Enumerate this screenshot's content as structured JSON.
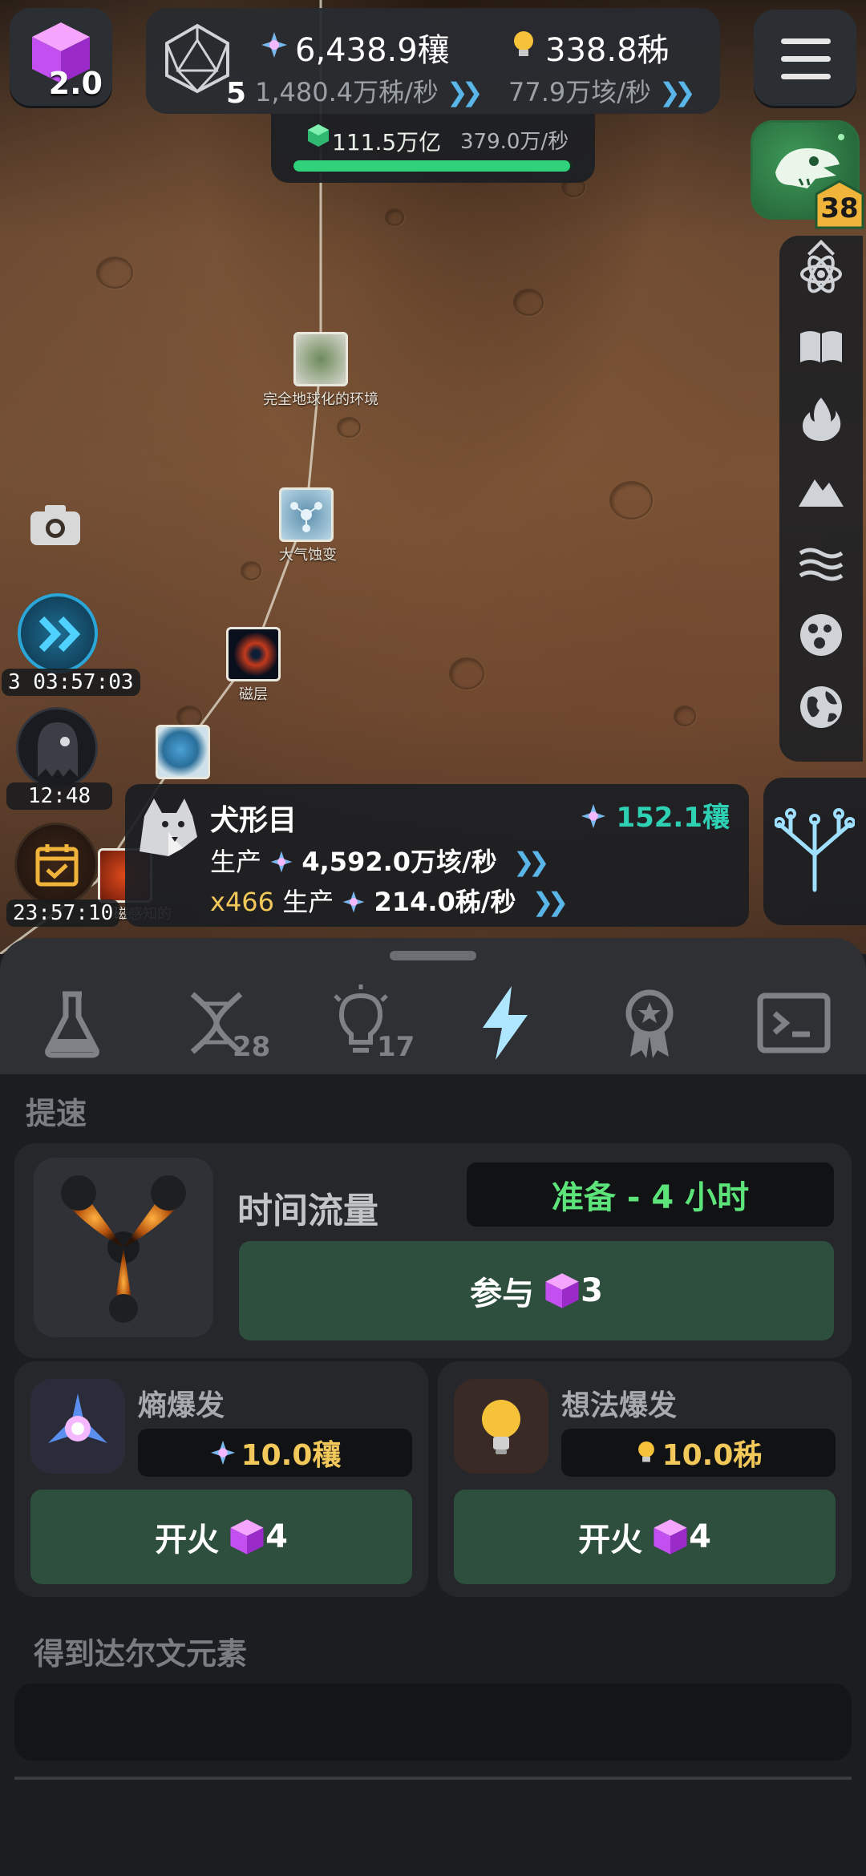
{
  "top": {
    "gem_level": "2.0",
    "d20_count": "5",
    "entropy_total": "6,438.9穰",
    "idea_total": "338.8秭",
    "entropy_rate": "1,480.4万秭/秒",
    "idea_rate": "77.9万垓/秒",
    "progress_value": "111.5万亿",
    "progress_rate": "379.0万/秒",
    "progress_fraction": 0.99,
    "dino_badge": "38"
  },
  "map": {
    "nodes": [
      {
        "label": "完全地球化的环境"
      },
      {
        "label": "大气蚀变"
      },
      {
        "label": "磁层"
      },
      {
        "label": ""
      },
      {
        "label": "磁感知的"
      }
    ],
    "timers": {
      "fast_forward": "3 03:57:03",
      "ghost": "12:48",
      "calendar": "23:57:10"
    }
  },
  "animal_card": {
    "name": "犬形目",
    "cost": "152.1穰",
    "produce_label": "生产",
    "produce_value": "4,592.0万垓/秒",
    "multiplier": "x466",
    "produce2_label": "生产",
    "produce2_value": "214.0秭/秒"
  },
  "tabs": [
    {
      "name": "science",
      "count": ""
    },
    {
      "name": "dna",
      "count": "28"
    },
    {
      "name": "ideas",
      "count": "17"
    },
    {
      "name": "boost",
      "count": ""
    },
    {
      "name": "achievements",
      "count": ""
    },
    {
      "name": "console",
      "count": ""
    }
  ],
  "boost": {
    "section_title": "提速",
    "time_flow": {
      "title": "时间流量",
      "status": "准备 - 4 小时",
      "button_label": "参与",
      "button_cost": "3"
    },
    "entropy_burst": {
      "title": "熵爆发",
      "amount": "10.0穰",
      "button_label": "开火",
      "button_cost": "4"
    },
    "idea_burst": {
      "title": "想法爆发",
      "amount": "10.0秭",
      "button_label": "开火",
      "button_cost": "4"
    },
    "darwin_title": "得到达尔文元素"
  },
  "colors": {
    "accent_green": "#2fd17a",
    "button_green": "#2f4f3e",
    "status_green": "#5ce37a",
    "gold": "#f2c85a",
    "teal": "#2fd1b5",
    "chevron_blue": "#5ab6e8",
    "gem_purple": "#c34ff0"
  }
}
